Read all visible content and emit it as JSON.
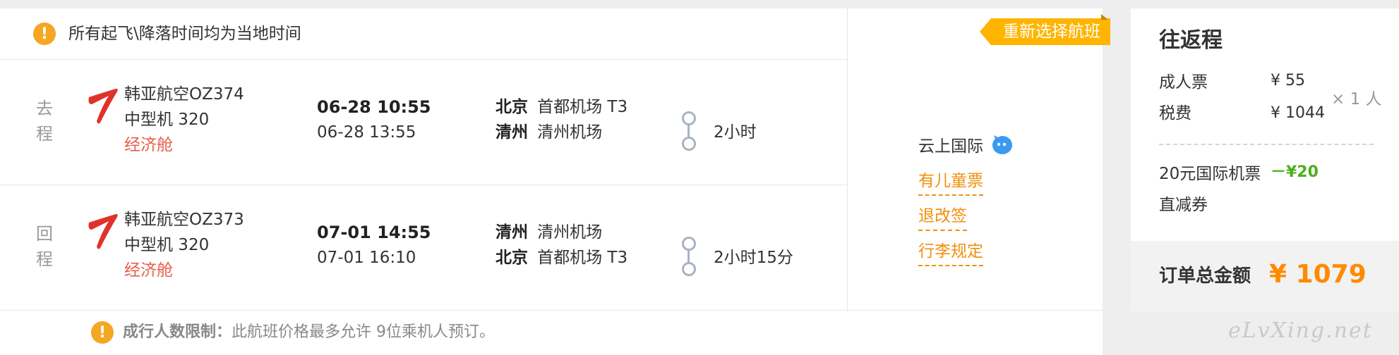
{
  "notice": {
    "text": "所有起飞\\降落时间均为当地时间"
  },
  "reselect_label": "重新选择航班",
  "flights": [
    {
      "direction": "去\n程",
      "airline_name": "韩亚航空OZ374",
      "aircraft": "中型机 320",
      "cabin": "经济舱",
      "depart_time": "06-28 10:55",
      "arrive_time": "06-28 13:55",
      "depart_city": "北京",
      "depart_airport": "首都机场 T3",
      "arrive_city": "清州",
      "arrive_airport": "清州机场",
      "duration": "2小时"
    },
    {
      "direction": "回\n程",
      "airline_name": "韩亚航空OZ373",
      "aircraft": "中型机 320",
      "cabin": "经济舱",
      "depart_time": "07-01 14:55",
      "arrive_time": "07-01 16:10",
      "depart_city": "清州",
      "depart_airport": "清州机场",
      "arrive_city": "北京",
      "arrive_airport": "首都机场 T3",
      "duration": "2小时15分"
    }
  ],
  "vendor": {
    "name": "云上国际",
    "links": [
      "有儿童票",
      "退改签",
      "行李规定"
    ]
  },
  "limit_notice": {
    "label": "成行人数限制：",
    "text": "此航班价格最多允许 9位乘机人预订。"
  },
  "price_panel": {
    "title": "往返程",
    "rows": [
      {
        "label": "成人票",
        "value": "¥ 55"
      },
      {
        "label": "税费",
        "value": "¥ 1044"
      }
    ],
    "multiplier": "× 1 人",
    "coupon_label_1": "20元国际机票",
    "coupon_label_2": "直减券",
    "coupon_value": "－¥20",
    "total_label": "订单总金额",
    "total_value": "¥ 1079"
  },
  "watermark": "eLvXing.net",
  "colors": {
    "accent_orange": "#f0900e",
    "badge_yellow": "#ffb400",
    "cabin_red": "#e85d4a",
    "coupon_green": "#4caf1f",
    "total_orange": "#ff8a00"
  }
}
